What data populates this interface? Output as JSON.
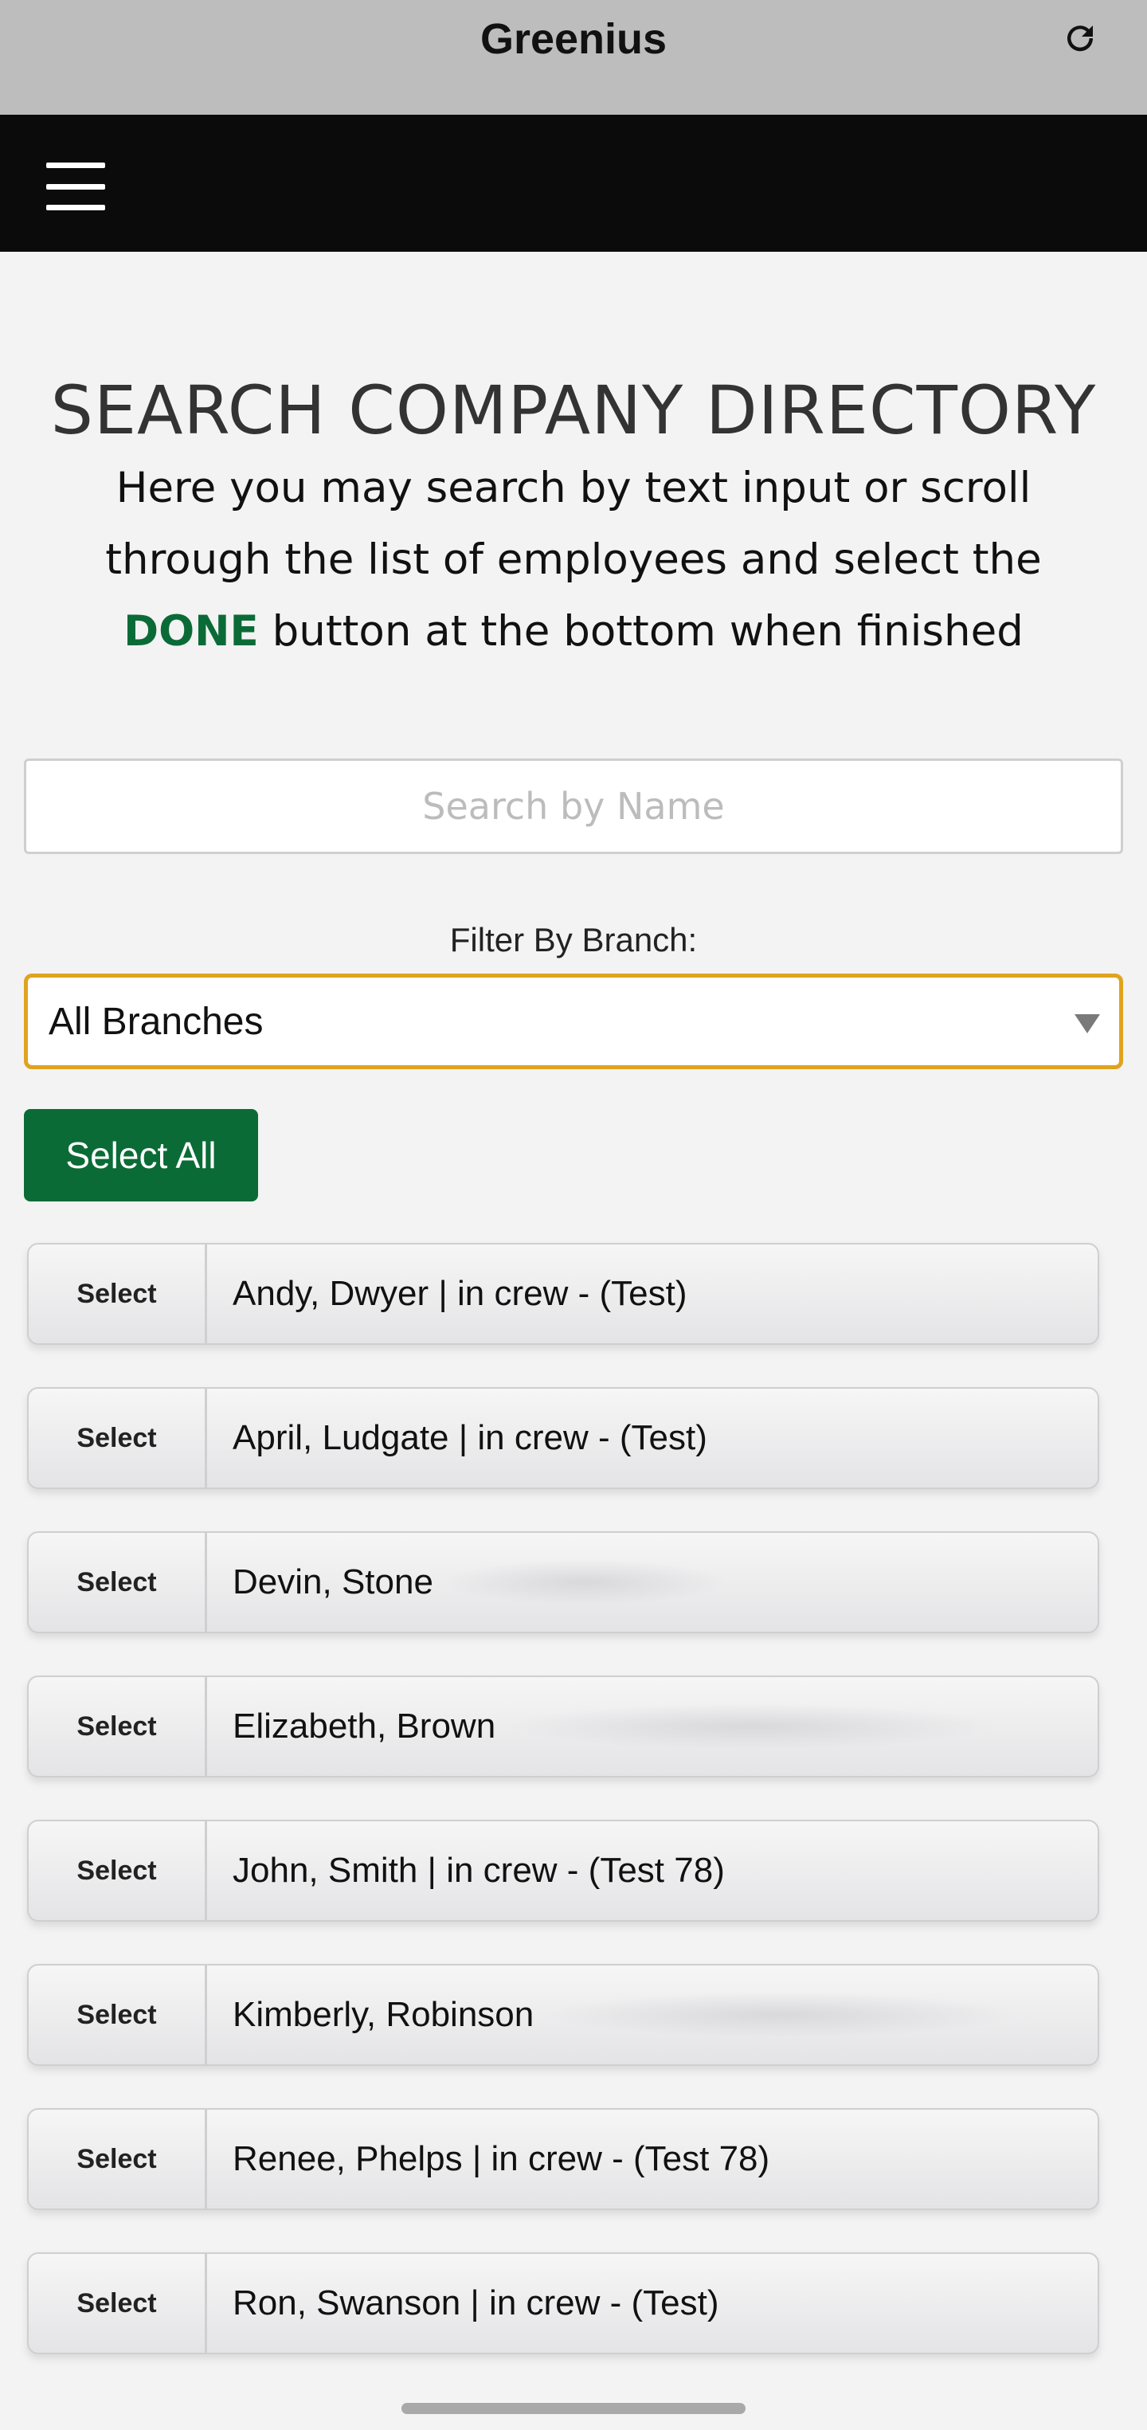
{
  "app": {
    "title": "Greenius"
  },
  "icons": {
    "refresh": "refresh-icon",
    "menu": "hamburger-menu-icon",
    "dropdown": "dropdown-arrow-icon"
  },
  "colors": {
    "accent_green": "#0b6b37",
    "select_border": "#e0a31e",
    "navbar": "#0b0b0b",
    "titlebar": "#bdbdbd"
  },
  "page": {
    "heading": "SEARCH COMPANY DIRECTORY",
    "intro_before": "Here you may search by text input or scroll through the list of employees and select the ",
    "intro_highlight": "DONE",
    "intro_after": " button at the bottom when finished"
  },
  "search": {
    "placeholder": "Search by Name",
    "value": ""
  },
  "filter": {
    "label": "Filter By Branch:",
    "selected": "All Branches"
  },
  "select_all_label": "Select All",
  "employees": [
    {
      "select_label": "Select",
      "name": "Andy, Dwyer | in crew - (Test)"
    },
    {
      "select_label": "Select",
      "name": "April, Ludgate | in crew - (Test)"
    },
    {
      "select_label": "Select",
      "name": "Devin, Stone"
    },
    {
      "select_label": "Select",
      "name": "Elizabeth, Brown"
    },
    {
      "select_label": "Select",
      "name": "John, Smith | in crew - (Test 78)"
    },
    {
      "select_label": "Select",
      "name": "Kimberly, Robinson"
    },
    {
      "select_label": "Select",
      "name": "Renee, Phelps | in crew - (Test 78)"
    },
    {
      "select_label": "Select",
      "name": "Ron, Swanson | in crew - (Test)"
    }
  ]
}
